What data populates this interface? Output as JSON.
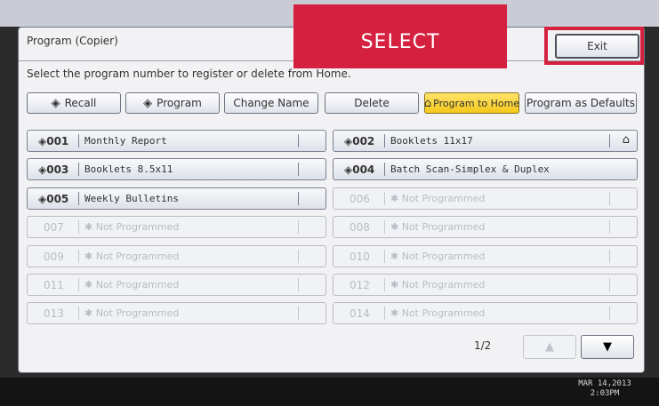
{
  "window": {
    "title": "Program (Copier)",
    "exit_label": "Exit"
  },
  "callout": {
    "label": "SELECT",
    "color": "#d5203f"
  },
  "instruction": "Select the program number to register or delete from Home.",
  "toolbar": {
    "recall": {
      "label": "Recall",
      "icon": "diamond-arrow-icon"
    },
    "program": {
      "label": "Program",
      "icon": "diamond-icon"
    },
    "change_name": "Change Name",
    "delete": "Delete",
    "program_to_home": {
      "label": "Program to Home",
      "icon": "home-icon",
      "color": "#f4c81a"
    },
    "program_as_defaults": "Program as Defaults"
  },
  "programs": [
    {
      "num": "001",
      "name": "Monthly Report",
      "home": false
    },
    {
      "num": "002",
      "name": "Booklets  11x17",
      "home": true
    },
    {
      "num": "003",
      "name": "Booklets 8.5x11",
      "home": false
    },
    {
      "num": "004",
      "name": "Batch Scan-Simplex & Duplex",
      "home": false
    },
    {
      "num": "005",
      "name": "Weekly Bulletins",
      "home": false
    },
    {
      "num": "006",
      "name": "Not Programmed",
      "disabled": true
    },
    {
      "num": "007",
      "name": "Not Programmed",
      "disabled": true
    },
    {
      "num": "008",
      "name": "Not Programmed",
      "disabled": true
    },
    {
      "num": "009",
      "name": "Not Programmed",
      "disabled": true
    },
    {
      "num": "010",
      "name": "Not Programmed",
      "disabled": true
    },
    {
      "num": "011",
      "name": "Not Programmed",
      "disabled": true
    },
    {
      "num": "012",
      "name": "Not Programmed",
      "disabled": true
    },
    {
      "num": "013",
      "name": "Not Programmed",
      "disabled": true
    },
    {
      "num": "014",
      "name": "Not Programmed",
      "disabled": true
    }
  ],
  "pagination": {
    "indicator": "1/2",
    "up_icon": "triangle-up-icon",
    "down_icon": "triangle-down-icon"
  },
  "status_bar": {
    "date": "MAR  14,2013",
    "time": "2:03PM"
  }
}
